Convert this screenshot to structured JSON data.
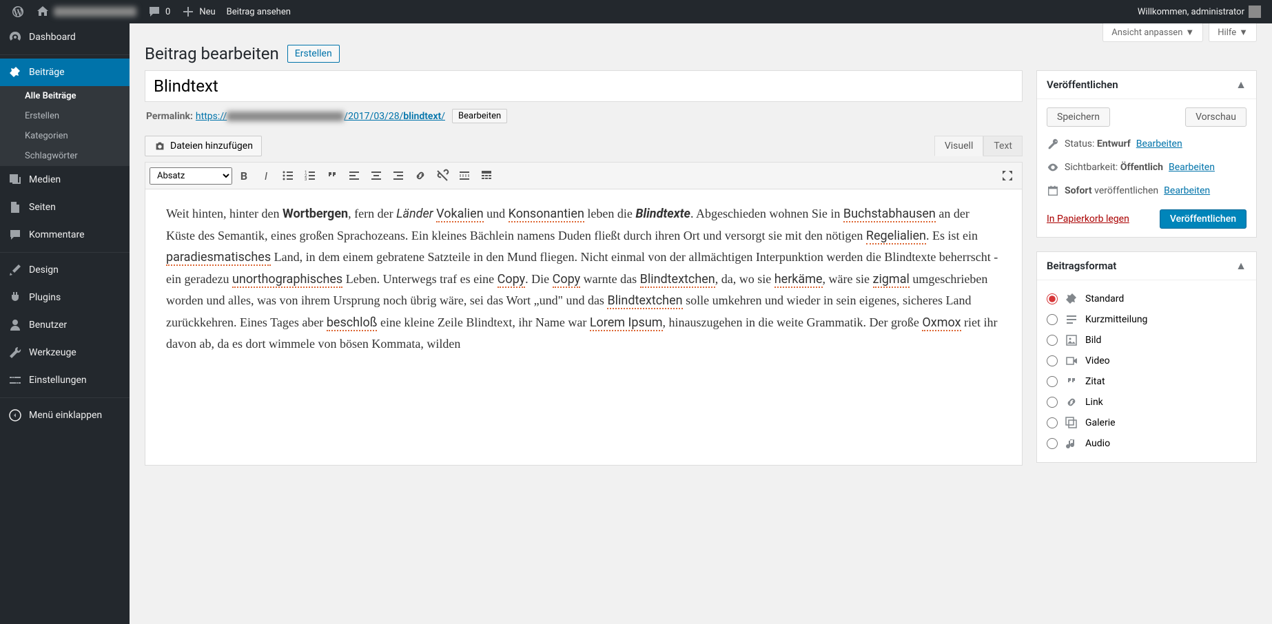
{
  "adminbar": {
    "site_name": "████████",
    "comment_count": "0",
    "new_label": "Neu",
    "view_post": "Beitrag ansehen",
    "greeting": "Willkommen, administrator"
  },
  "sidebar": {
    "dashboard": "Dashboard",
    "posts": "Beiträge",
    "posts_sub": {
      "all": "Alle Beiträge",
      "new": "Erstellen",
      "categories": "Kategorien",
      "tags": "Schlagwörter"
    },
    "media": "Medien",
    "pages": "Seiten",
    "comments": "Kommentare",
    "appearance": "Design",
    "plugins": "Plugins",
    "users": "Benutzer",
    "tools": "Werkzeuge",
    "settings": "Einstellungen",
    "collapse": "Menü einklappen"
  },
  "screen_options": "Ansicht anpassen",
  "help": "Hilfe",
  "page_title": "Beitrag bearbeiten",
  "add_new": "Erstellen",
  "post_title": "Blindtext",
  "permalink": {
    "label": "Permalink:",
    "url_prefix": "https://",
    "url_blur": "████████████████",
    "url_date": "/2017/03/28/",
    "slug": "blindtext",
    "trail": "/",
    "edit": "Bearbeiten"
  },
  "media_button": "Dateien hinzufügen",
  "editor_tabs": {
    "visual": "Visuell",
    "text": "Text"
  },
  "format_select": "Absatz",
  "editor_body_html": "Weit hinten, hinter den <b>Wortbergen</b>, fern der <i>Länder</i> <span class='red-under'>Vokalien</span> und <span class='red-under'>Konsonantien</span> leben die <b><i>Blindtexte</i></b>. Abgeschieden wohnen Sie in <span class='red-under'>Buchstabhausen</span> an der Küste des Semantik, eines großen Sprachozeans. Ein kleines Bächlein namens Duden fließt durch ihren Ort und versorgt sie mit den nötigen <span class='red-under'>Regelialien</span>. Es ist ein <span class='red-under'>paradiesmatisches</span> Land, in dem einem gebratene Satzteile in den Mund fliegen. Nicht einmal von der allmächtigen Interpunktion werden die Blindtexte beherrscht - ein geradezu <span class='red-under'>unorthographisches</span> Leben. Unterwegs traf es eine <span class='red-under'>Copy</span>. Die <span class='red-under'>Copy</span> warnte das <span class='red-under'>Blindtextchen</span>, da, wo sie <span class='red-under'>herkäme</span>, wäre sie <span class='red-under'>zigmal</span> umgeschrieben worden und alles, was von ihrem Ursprung noch übrig wäre, sei das Wort „und\" und das <span class='red-under'>Blindtextchen</span> solle umkehren und wieder in sein eigenes, sicheres Land zurückkehren. Eines Tages aber <span class='red-under'>beschloß</span> eine kleine Zeile Blindtext, ihr Name war <span class='red-under'>Lorem Ipsum</span>, hinauszugehen in die weite Grammatik. Der große <span class='red-under'>Oxmox</span> riet ihr davon ab, da es dort wimmele von bösen Kommata, wilden",
  "publish_box": {
    "title": "Veröffentlichen",
    "save": "Speichern",
    "preview": "Vorschau",
    "status_label": "Status:",
    "status_value": "Entwurf",
    "status_edit": "Bearbeiten",
    "visibility_label": "Sichtbarkeit:",
    "visibility_value": "Öffentlich",
    "visibility_edit": "Bearbeiten",
    "sched_prefix": "Sofort",
    "sched_suffix": "veröffentlichen",
    "sched_edit": "Bearbeiten",
    "trash": "In Papierkorb legen",
    "publish": "Veröffentlichen"
  },
  "format_box": {
    "title": "Beitragsformat",
    "options": [
      {
        "label": "Standard",
        "selected": true
      },
      {
        "label": "Kurzmitteilung",
        "selected": false
      },
      {
        "label": "Bild",
        "selected": false
      },
      {
        "label": "Video",
        "selected": false
      },
      {
        "label": "Zitat",
        "selected": false
      },
      {
        "label": "Link",
        "selected": false
      },
      {
        "label": "Galerie",
        "selected": false
      },
      {
        "label": "Audio",
        "selected": false
      }
    ]
  }
}
